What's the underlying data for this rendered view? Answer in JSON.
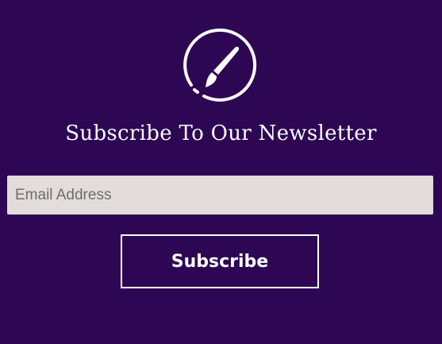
{
  "newsletter": {
    "logo_icon": "paintbrush-circle-icon",
    "title": "Subscribe To Our Newsletter",
    "email_placeholder": "Email Address",
    "email_value": "",
    "subscribe_label": "Subscribe"
  },
  "colors": {
    "background": "#2d0654",
    "input_background": "#e3dcdc",
    "text": "#ffffff"
  }
}
